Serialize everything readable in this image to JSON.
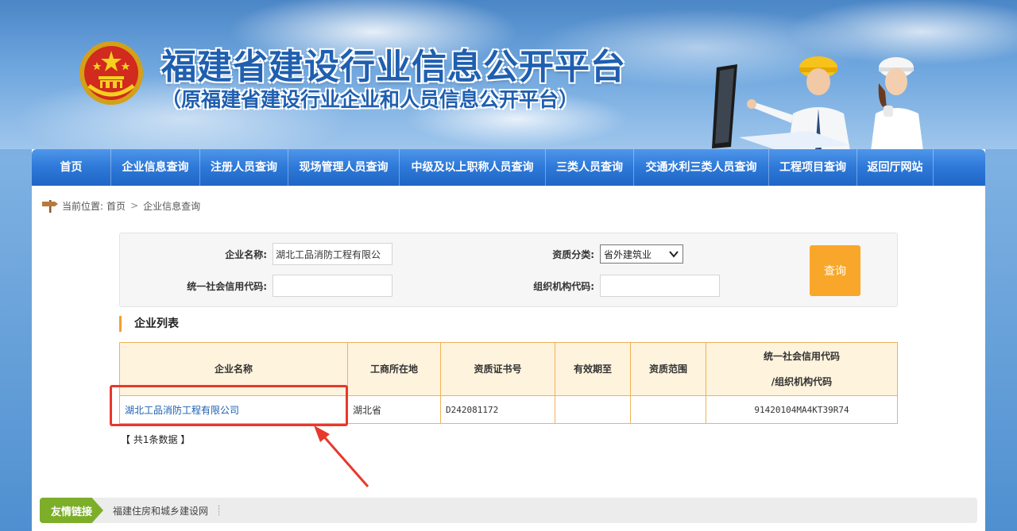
{
  "header": {
    "title": "福建省建设行业信息公开平台",
    "subtitle": "（原福建省建设行业企业和人员信息公开平台）"
  },
  "nav": {
    "items": [
      {
        "label": "首页"
      },
      {
        "label": "企业信息查询"
      },
      {
        "label": "注册人员查询"
      },
      {
        "label": "现场管理人员查询"
      },
      {
        "label": "中级及以上职称人员查询"
      },
      {
        "label": "三类人员查询"
      },
      {
        "label": "交通水利三类人员查询"
      },
      {
        "label": "工程项目查询"
      },
      {
        "label": "返回厅网站"
      }
    ]
  },
  "breadcrumb": {
    "prefix": "当前位置:",
    "home": "首页",
    "separator": ">",
    "current": "企业信息查询"
  },
  "search": {
    "company_name_label": "企业名称:",
    "company_name_value": "湖北工品消防工程有限公",
    "qualification_label": "资质分类:",
    "qualification_value": "省外建筑业",
    "credit_code_label": "统一社会信用代码:",
    "credit_code_value": "",
    "org_code_label": "组织机构代码:",
    "org_code_value": "",
    "query_button": "查询"
  },
  "list": {
    "title": "企业列表",
    "headers": [
      "企业名称",
      "工商所在地",
      "资质证书号",
      "有效期至",
      "资质范围",
      "统一社会信用代码",
      "/组织机构代码"
    ],
    "rows": [
      {
        "name": "湖北工品消防工程有限公司",
        "location": "湖北省",
        "cert_no": "D242081172",
        "valid_until": "",
        "scope": "",
        "credit_code": "91420104MA4KT39R74"
      }
    ],
    "count_text": "【  共1条数据  】"
  },
  "links": {
    "label": "友情链接",
    "items": [
      "福建住房和城乡建设网"
    ],
    "divider": "┊"
  },
  "colors": {
    "nav_blue": "#2d78d8",
    "query_orange": "#f9a72a",
    "table_border": "#f0b25a",
    "table_header_bg": "#fef3dc",
    "annotation_red": "#e8382c",
    "links_green": "#7cae2a"
  }
}
